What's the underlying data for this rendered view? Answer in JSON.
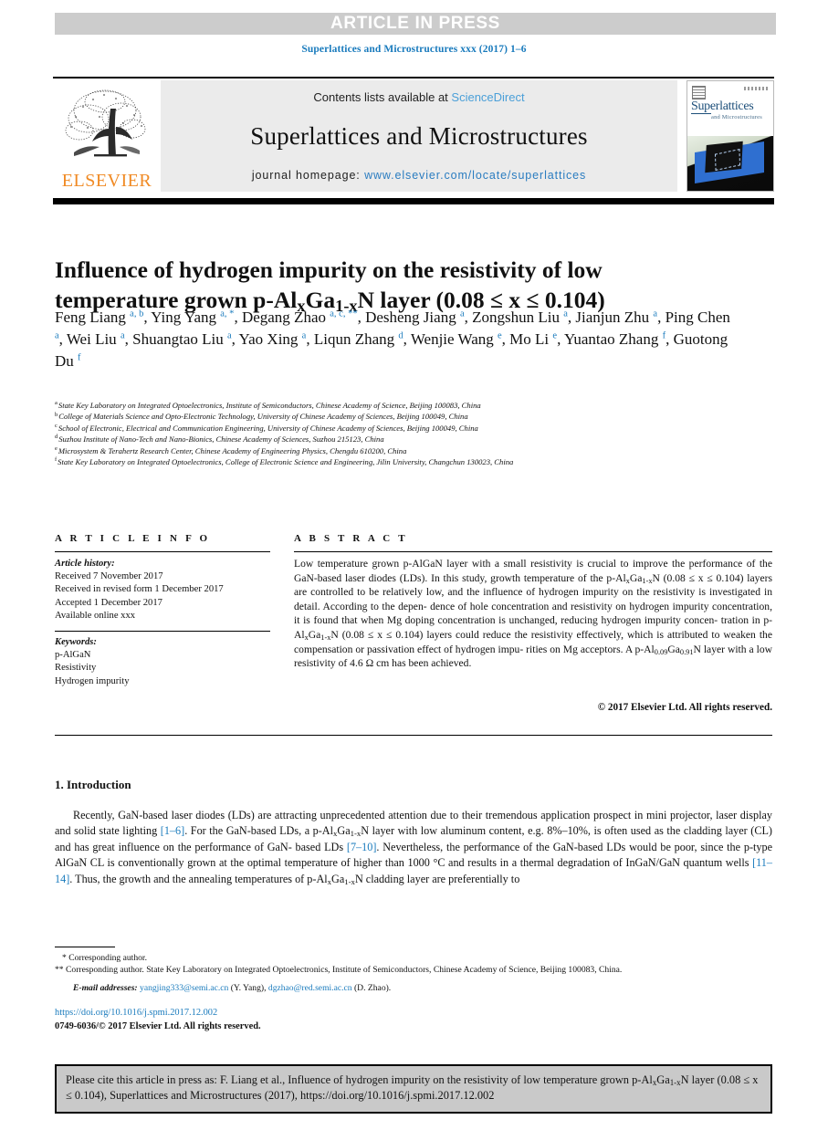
{
  "banner": {
    "article_in_press": "ARTICLE IN PRESS",
    "background_color": "#cccccc",
    "text_color": "#ffffff"
  },
  "running_head": {
    "text": "Superlattices and Microstructures xxx (2017) 1–6",
    "color": "#1a7bbd"
  },
  "masthead": {
    "publisher_logo_word": "ELSEVIER",
    "publisher_logo_color": "#f08a24",
    "contents_prefix": "Contents lists available at ",
    "contents_link": "ScienceDirect",
    "contents_link_color": "#4a9fd8",
    "journal_title": "Superlattices and Microstructures",
    "homepage_label": "journal homepage: ",
    "homepage_url": "www.elsevier.com/locate/superlattices",
    "homepage_url_color": "#2a7cc0",
    "cover": {
      "title": "Superlattices",
      "subtitle": "and Microstructures"
    }
  },
  "title": {
    "line1": "Influence of hydrogen impurity on the resistivity of low",
    "line2_pre": "temperature grown p-Al",
    "line2_sub1": "x",
    "line2_mid": "Ga",
    "line2_sub2": "1-x",
    "line2_post": "N layer (0.08 ≤ x ≤ 0.104)"
  },
  "authors": {
    "list": [
      {
        "name": "Feng Liang",
        "marks": "a, b",
        "sep": ","
      },
      {
        "name": "Ying Yang",
        "marks": "a, *",
        "sep": ","
      },
      {
        "name": "Degang Zhao",
        "marks": "a, c, **",
        "sep": ","
      },
      {
        "name": "Desheng Jiang",
        "marks": "a",
        "sep": ","
      },
      {
        "name": "Zongshun Liu",
        "marks": "a",
        "sep": ","
      },
      {
        "name": "Jianjun Zhu",
        "marks": "a",
        "sep": ","
      },
      {
        "name": "Ping Chen",
        "marks": "a",
        "sep": ","
      },
      {
        "name": "Wei Liu",
        "marks": "a",
        "sep": ","
      },
      {
        "name": "Shuangtao Liu",
        "marks": "a",
        "sep": ","
      },
      {
        "name": "Yao Xing",
        "marks": "a",
        "sep": ","
      },
      {
        "name": "Liqun Zhang",
        "marks": "d",
        "sep": ","
      },
      {
        "name": "Wenjie Wang",
        "marks": "e",
        "sep": ","
      },
      {
        "name": "Mo Li",
        "marks": "e",
        "sep": ","
      },
      {
        "name": "Yuantao Zhang",
        "marks": "f",
        "sep": ","
      },
      {
        "name": "Guotong Du",
        "marks": "f",
        "sep": ""
      }
    ],
    "mark_color": "#1a7bbd"
  },
  "affiliations": [
    {
      "mark": "a",
      "text": "State Key Laboratory on Integrated Optoelectronics, Institute of Semiconductors, Chinese Academy of Science, Beijing 100083, China"
    },
    {
      "mark": "b",
      "text": "College of Materials Science and Opto-Electronic Technology, University of Chinese Academy of Sciences, Beijing 100049, China"
    },
    {
      "mark": "c",
      "text": "School of Electronic, Electrical and Communication Engineering, University of Chinese Academy of Sciences, Beijing 100049, China"
    },
    {
      "mark": "d",
      "text": "Suzhou Institute of Nano-Tech and Nano-Bionics, Chinese Academy of Sciences, Suzhou 215123, China"
    },
    {
      "mark": "e",
      "text": "Microsystem & Terahertz Research Center, Chinese Academy of Engineering Physics, Chengdu 610200, China"
    },
    {
      "mark": "f",
      "text": "State Key Laboratory on Integrated Optoelectronics, College of Electronic Science and Engineering, Jilin University, Changchun 130023, China"
    }
  ],
  "article_info": {
    "heading": "A R T I C L E  I N F O",
    "history_label": "Article history:",
    "history": [
      "Received 7 November 2017",
      "Received in revised form 1 December 2017",
      "Accepted 1 December 2017",
      "Available online xxx"
    ],
    "keywords_label": "Keywords:",
    "keywords": [
      "p-AlGaN",
      "Resistivity",
      "Hydrogen impurity"
    ]
  },
  "abstract": {
    "heading": "A B S T R A C T",
    "copyright": "© 2017 Elsevier Ltd. All rights reserved."
  },
  "introduction": {
    "number_title": "1. Introduction"
  },
  "footnotes": {
    "star_single": "* Corresponding author.",
    "star_double": "** Corresponding author. State Key Laboratory on Integrated Optoelectronics, Institute of Semiconductors, Chinese Academy of Science, Beijing 100083, China.",
    "email_label": "E-mail addresses:",
    "email1": "yangjing333@semi.ac.cn",
    "email1_owner": "(Y. Yang),",
    "email2": "dgzhao@red.semi.ac.cn",
    "email2_owner": "(D. Zhao).",
    "link_color": "#1a7bbd"
  },
  "doi": {
    "url": "https://doi.org/10.1016/j.spmi.2017.12.002",
    "issn_copyright": "0749-6036/© 2017 Elsevier Ltd. All rights reserved."
  },
  "cite_box": {
    "background_color": "#c9c9c9",
    "prefix": "Please cite this article in press as: F. Liang et al., Influence of hydrogen impurity on the resistivity of low temperature grown p-Al",
    "sub1": "x",
    "mid": "Ga",
    "sub2": "1-x",
    "suffix": "N layer (0.08 ≤ x ≤ 0.104), Superlattices and Microstructures (2017), https://doi.org/10.1016/j.spmi.2017.12.002"
  }
}
